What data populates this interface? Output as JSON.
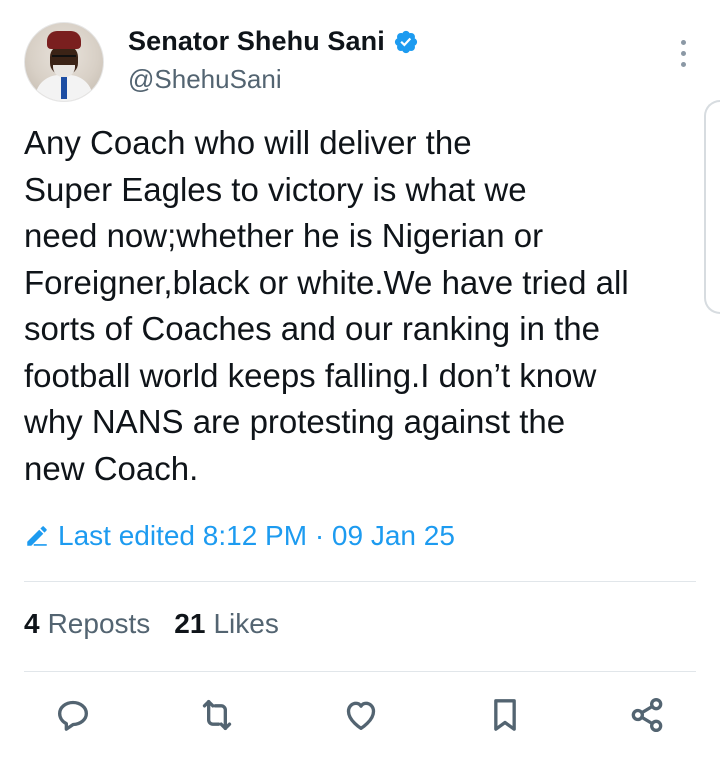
{
  "author": {
    "name": "Senator Shehu Sani",
    "handle": "@ShehuSani",
    "verified": true,
    "verified_color": "#1d9bf0"
  },
  "tweet": {
    "text": "Any Coach who will deliver the\nSuper Eagles to victory is what we\nneed now;whether he is Nigerian or\nForeigner,black or white.We have tried all\nsorts of Coaches and our ranking in the\nfootball world keeps falling.I don’t know\nwhy NANS are protesting against the\nnew Coach.",
    "edited_label": "Last edited 8:12 PM · 09 Jan 25"
  },
  "stats": {
    "reposts_count": "4",
    "reposts_label": "Reposts",
    "likes_count": "21",
    "likes_label": "Likes"
  },
  "icons": {
    "menu": "more-vertical-icon",
    "edit": "pencil-icon",
    "reply": "reply-icon",
    "repost": "repost-icon",
    "like": "heart-icon",
    "bookmark": "bookmark-icon",
    "share": "share-icon"
  },
  "colors": {
    "accent": "#1d9bf0",
    "text": "#0f1419",
    "secondary_text": "#536471",
    "icon_gray": "#536471"
  }
}
